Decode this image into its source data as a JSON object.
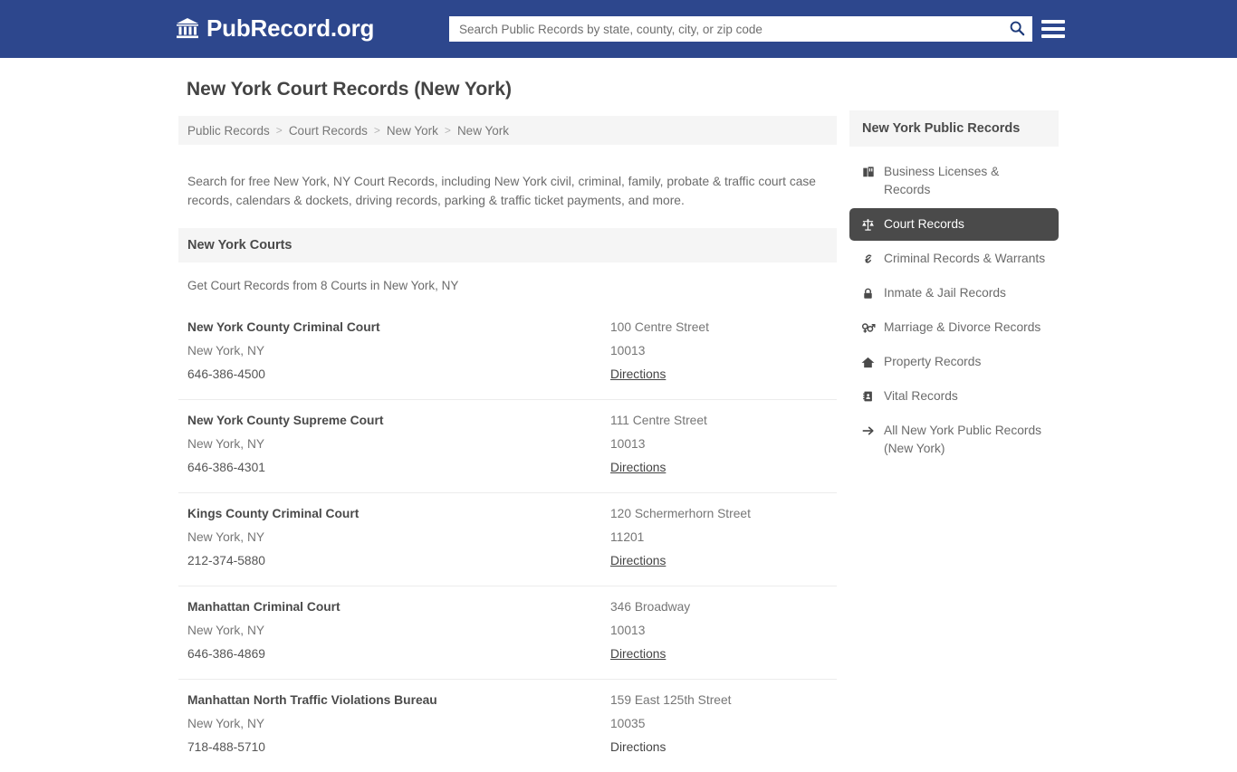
{
  "header": {
    "brand_name": "PubRecord.org",
    "brand_icon": "bank-building-icon",
    "search_placeholder": "Search Public Records by state, county, city, or zip code",
    "search_value": "",
    "search_icon": "search-icon",
    "menu_icon": "hamburger-menu-icon"
  },
  "main": {
    "page_title": "New York Court Records (New York)",
    "breadcrumb": [
      {
        "label": "Public Records"
      },
      {
        "label": "Court Records"
      },
      {
        "label": "New York"
      },
      {
        "label": "New York"
      }
    ],
    "breadcrumb_separator": ">",
    "intro": "Search for free New York, NY Court Records, including New York civil, criminal, family, probate & traffic court case records, calendars & dockets, driving records, parking & traffic ticket payments, and more.",
    "section_title": "New York Courts",
    "section_note": "Get Court Records from 8 Courts in New York, NY",
    "courts": [
      {
        "name": "New York County Criminal Court",
        "city_state": "New York, NY",
        "phone": "646-386-4500",
        "street": "100 Centre Street",
        "zip": "10013",
        "directions": "Directions",
        "directions_link": true
      },
      {
        "name": "New York County Supreme Court",
        "city_state": "New York, NY",
        "phone": "646-386-4301",
        "street": "111 Centre Street",
        "zip": "10013",
        "directions": "Directions",
        "directions_link": true
      },
      {
        "name": "Kings County Criminal Court",
        "city_state": "New York, NY",
        "phone": "212-374-5880",
        "street": "120 Schermerhorn Street",
        "zip": "11201",
        "directions": "Directions",
        "directions_link": true
      },
      {
        "name": "Manhattan Criminal Court",
        "city_state": "New York, NY",
        "phone": "646-386-4869",
        "street": "346 Broadway",
        "zip": "10013",
        "directions": "Directions",
        "directions_link": true
      },
      {
        "name": "Manhattan North Traffic Violations Bureau",
        "city_state": "New York, NY",
        "phone": "718-488-5710",
        "street": "159 East 125th Street",
        "zip": "10035",
        "directions": "Directions",
        "directions_link": false
      }
    ]
  },
  "sidebar": {
    "title": "New York Public Records",
    "items": [
      {
        "label": "Business Licenses & Records",
        "icon": "briefcase-icon",
        "active": false
      },
      {
        "label": "Court Records",
        "icon": "scales-of-justice-icon",
        "active": true
      },
      {
        "label": "Criminal Records & Warrants",
        "icon": "link-chain-icon",
        "active": false
      },
      {
        "label": "Inmate & Jail Records",
        "icon": "lock-icon",
        "active": false
      },
      {
        "label": "Marriage & Divorce Records",
        "icon": "venus-mars-icon",
        "active": false
      },
      {
        "label": "Property Records",
        "icon": "home-icon",
        "active": false
      },
      {
        "label": "Vital Records",
        "icon": "address-book-icon",
        "active": false
      },
      {
        "label": "All New York Public Records (New York)",
        "icon": "arrow-right-icon",
        "active": false
      }
    ]
  },
  "colors": {
    "header_blue": "#2d478d",
    "active_gray": "#4a4a4a",
    "panel_gray": "#f5f5f5",
    "text_gray": "#6b6b6b"
  }
}
